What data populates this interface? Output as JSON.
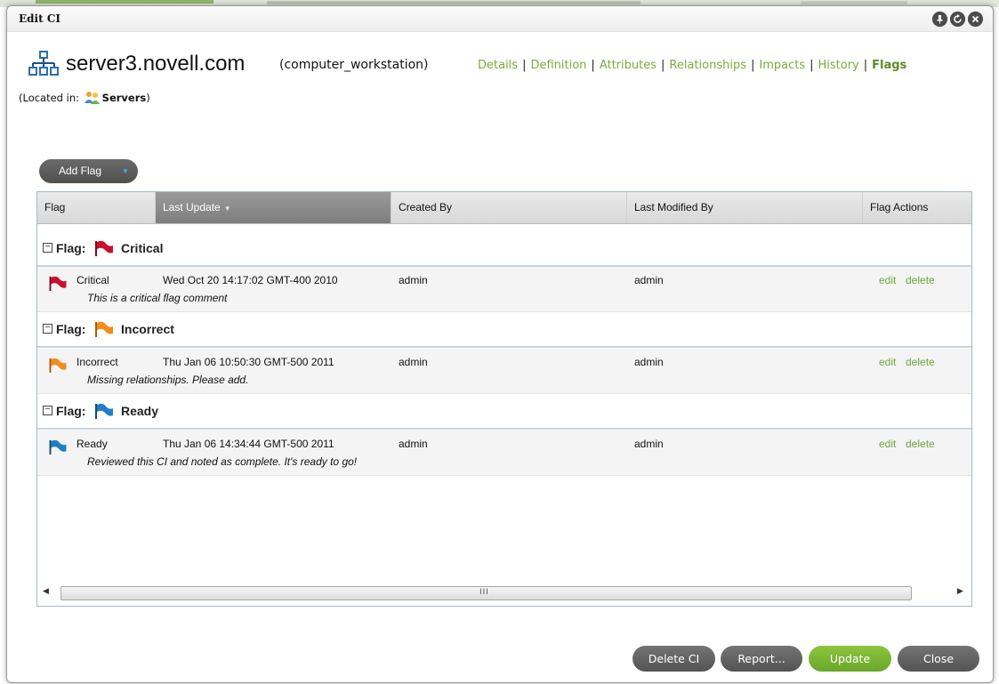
{
  "window": {
    "title": "Edit CI"
  },
  "title_buttons": [
    "pin-icon",
    "refresh-icon",
    "close-icon"
  ],
  "ci": {
    "name": "server3.novell.com",
    "type": "(computer_workstation)",
    "located_label": "(Located in:",
    "located_name": "Servers",
    "located_close": ")"
  },
  "nav": {
    "links": [
      {
        "label": "Details",
        "active": false
      },
      {
        "label": "Definition",
        "active": false
      },
      {
        "label": "Attributes",
        "active": false
      },
      {
        "label": "Relationships",
        "active": false
      },
      {
        "label": "Impacts",
        "active": false
      },
      {
        "label": "History",
        "active": false
      },
      {
        "label": "Flags",
        "active": true
      }
    ],
    "separator": "|"
  },
  "toolbar": {
    "add_flag_label": "Add Flag",
    "add_flag_caret": "▼"
  },
  "grid": {
    "columns": [
      "Flag",
      "Last Update",
      "Created By",
      "Last Modified By",
      "Flag Actions"
    ],
    "sorted_column": "Last Update",
    "sort_arrow": "▼",
    "group_prefix": "Flag:",
    "groups": [
      {
        "name": "Critical",
        "color": "#c8102e",
        "row": {
          "flag": "Critical",
          "last_update": "Wed Oct 20 14:17:02 GMT-400 2010",
          "created_by": "admin",
          "modified_by": "admin",
          "comment": "This is a critical flag comment"
        }
      },
      {
        "name": "Incorrect",
        "color": "#f28c1c",
        "row": {
          "flag": "Incorrect",
          "last_update": "Thu Jan 06 10:50:30 GMT-500 2011",
          "created_by": "admin",
          "modified_by": "admin",
          "comment": "Missing relationships. Please add."
        }
      },
      {
        "name": "Ready",
        "color": "#1f7fc4",
        "row": {
          "flag": "Ready",
          "last_update": "Thu Jan 06 14:34:44 GMT-500 2011",
          "created_by": "admin",
          "modified_by": "admin",
          "comment": "Reviewed this CI and noted as complete. It's ready to go!"
        }
      }
    ],
    "actions": {
      "edit": "edit",
      "delete": "delete"
    },
    "scroll_grip": "III"
  },
  "footer": {
    "delete_ci": "Delete CI",
    "report": "Report...",
    "update": "Update",
    "close": "Close"
  },
  "colors": {
    "link": "#7aab3c",
    "accent": "#6aa62a",
    "button_dark": "#545454"
  }
}
